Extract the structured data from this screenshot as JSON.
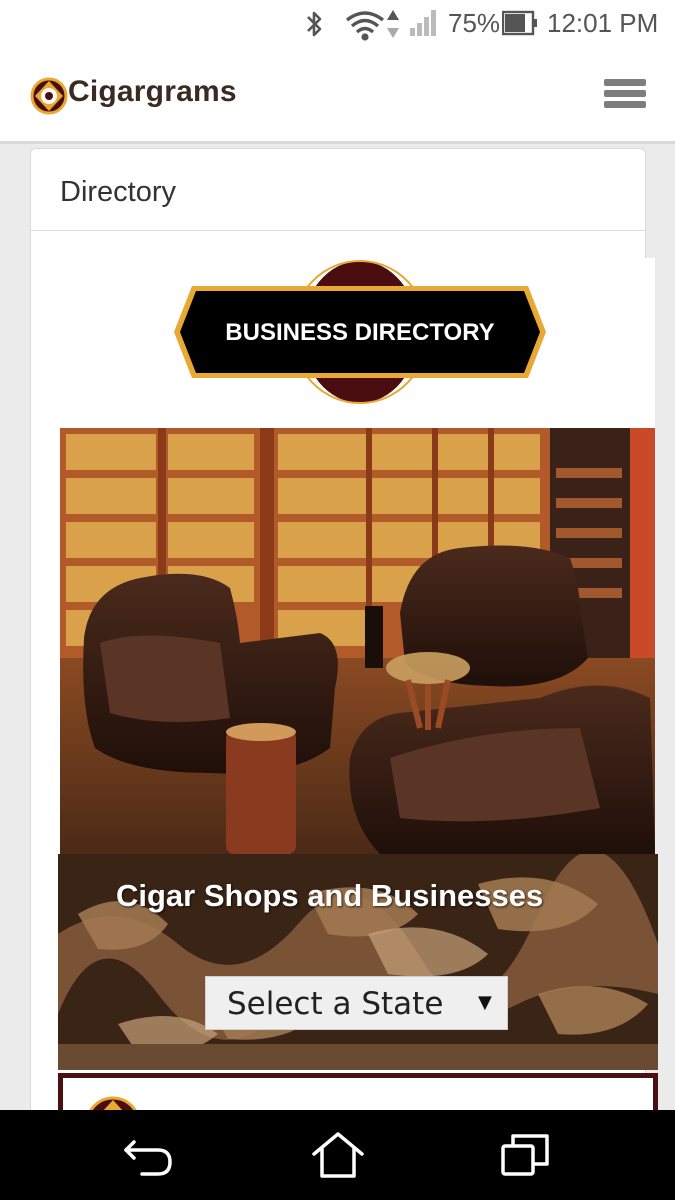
{
  "status_bar": {
    "battery": "75%",
    "time": "12:01 PM",
    "icons": [
      "bluetooth-icon",
      "wifi-icon",
      "cell-signal-icon",
      "battery-icon"
    ]
  },
  "header": {
    "app_name": "Cigargrams",
    "menu_icon": "hamburger-menu-icon"
  },
  "card": {
    "title": "Directory"
  },
  "badge": {
    "label": "BUSINESS DIRECTORY"
  },
  "shops": {
    "title": "Cigar Shops and Businesses",
    "state_select": {
      "selected": "Select a State"
    }
  },
  "nav": {
    "icons": [
      "back-icon",
      "home-icon",
      "recent-apps-icon"
    ]
  },
  "colors": {
    "badge_maroon": "#4a0d10",
    "badge_gold": "#e8a832",
    "logo_brown": "#3a2a22"
  }
}
